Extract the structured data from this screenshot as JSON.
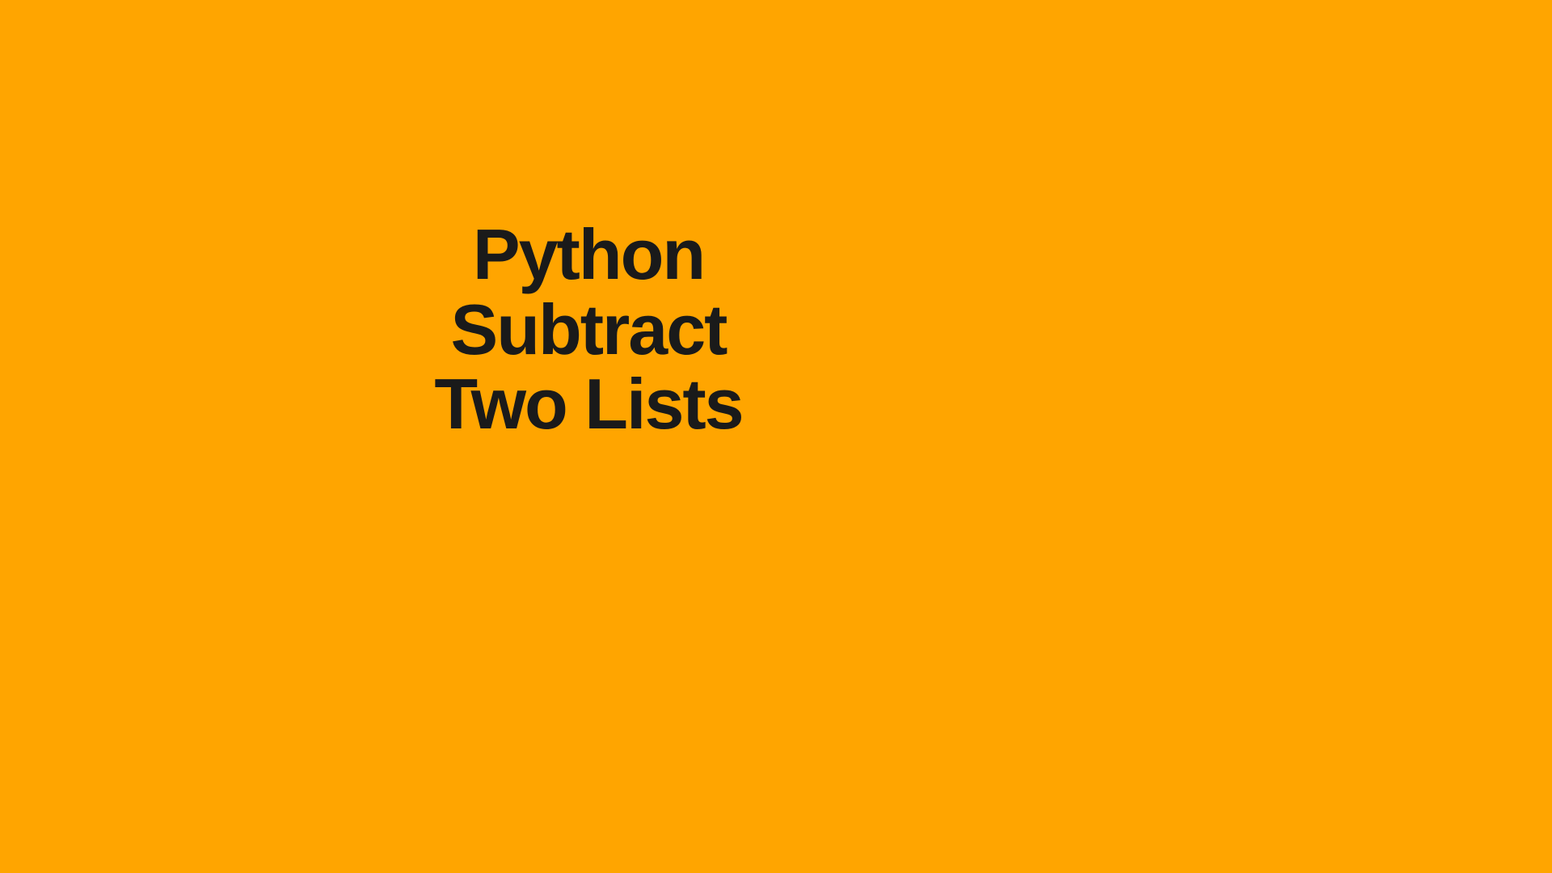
{
  "title": {
    "line1": "Python",
    "line2": "Subtract",
    "line3": "Two Lists"
  },
  "colors": {
    "background": "#FFA500",
    "text": "#1a1a1a"
  }
}
